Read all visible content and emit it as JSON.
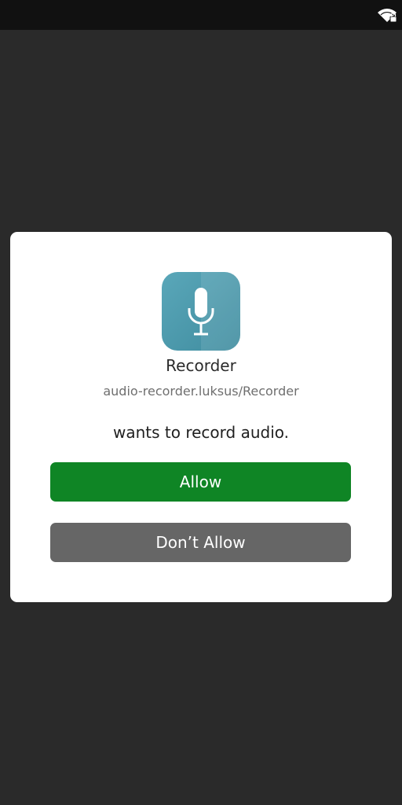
{
  "status_bar": {
    "icons": [
      "wifi-locked-icon"
    ]
  },
  "dialog": {
    "app_icon": "microphone-icon",
    "app_name": "Recorder",
    "app_id": "audio-recorder.luksus/Recorder",
    "message": "wants to record audio.",
    "allow_label": "Allow",
    "deny_label": "Don’t Allow"
  },
  "colors": {
    "background": "#2a2a2a",
    "status_bar": "#111111",
    "dialog": "#ffffff",
    "icon_bg": "#4f9aac",
    "allow_button": "#0f8525",
    "deny_button": "#666666"
  }
}
